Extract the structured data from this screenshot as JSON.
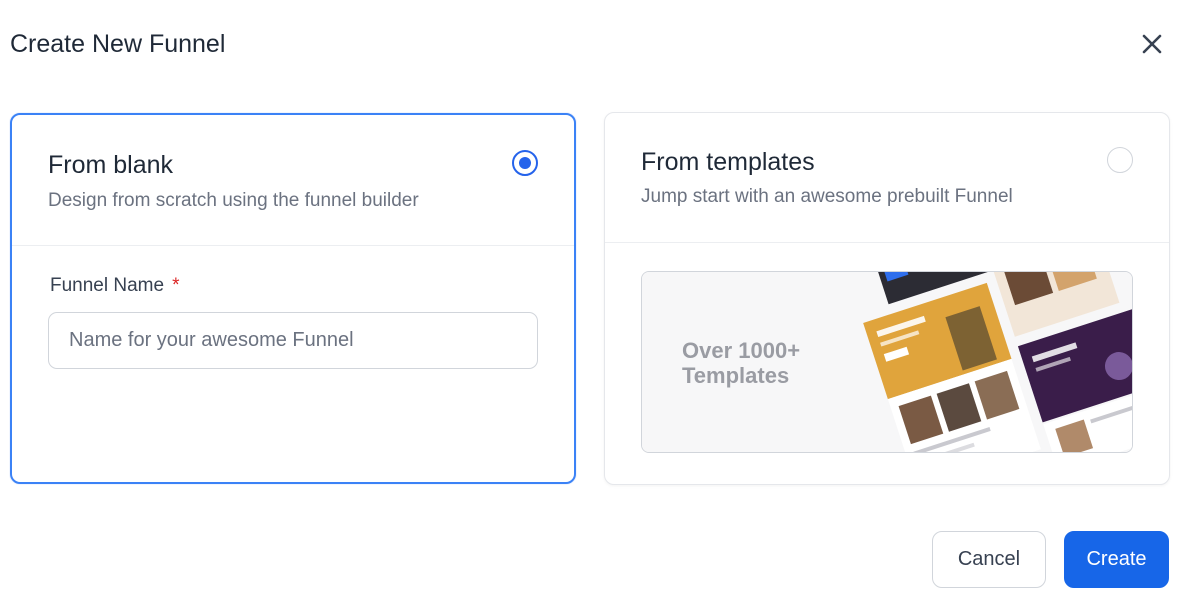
{
  "dialog": {
    "title": "Create New Funnel"
  },
  "options": {
    "blank": {
      "title": "From blank",
      "subtitle": "Design from scratch using the funnel builder",
      "selected": true,
      "field": {
        "label": "Funnel Name",
        "required_mark": "*",
        "value": "",
        "placeholder": "Name for your awesome Funnel"
      }
    },
    "templates": {
      "title": "From templates",
      "subtitle": "Jump start with an awesome prebuilt Funnel",
      "selected": false,
      "preview_line1": "Over 1000+",
      "preview_line2": "Templates"
    }
  },
  "footer": {
    "cancel_label": "Cancel",
    "create_label": "Create"
  },
  "colors": {
    "accent": "#2563eb",
    "primary_button": "#1766e8",
    "required": "#dc2626",
    "template_orange": "#e0a43c",
    "template_purple": "#3a1d4a"
  },
  "icons": {
    "close": "close-icon"
  }
}
